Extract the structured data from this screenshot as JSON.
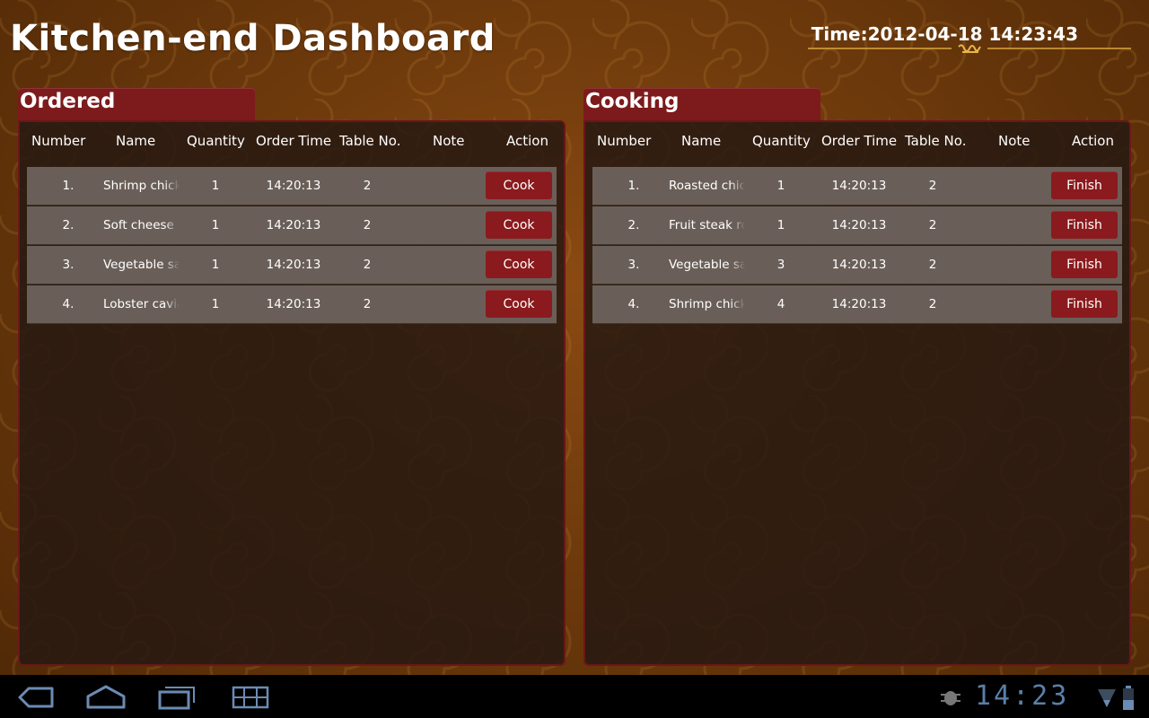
{
  "header": {
    "title": "Kitchen-end Dashboard",
    "time_label": "Time:2012-04-18 14:23:43"
  },
  "columns": [
    "Number",
    "Name",
    "Quantity",
    "Order Time",
    "Table No.",
    "Note",
    "Action"
  ],
  "ordered": {
    "title": "Ordered",
    "action_label": "Cook",
    "rows": [
      {
        "num": "1.",
        "name": "Shrimp chicken",
        "qty": "1",
        "time": "14:20:13",
        "table": "2"
      },
      {
        "num": "2.",
        "name": "Soft cheese with",
        "qty": "1",
        "time": "14:20:13",
        "table": "2"
      },
      {
        "num": "3.",
        "name": "Vegetable salad",
        "qty": "1",
        "time": "14:20:13",
        "table": "2"
      },
      {
        "num": "4.",
        "name": "Lobster caviar",
        "qty": "1",
        "time": "14:20:13",
        "table": "2"
      }
    ]
  },
  "cooking": {
    "title": "Cooking",
    "action_label": "Finish",
    "rows": [
      {
        "num": "1.",
        "name": "Roasted chicken",
        "qty": "1",
        "time": "14:20:13",
        "table": "2"
      },
      {
        "num": "2.",
        "name": "Fruit steak roll",
        "qty": "1",
        "time": "14:20:13",
        "table": "2"
      },
      {
        "num": "3.",
        "name": "Vegetable salad",
        "qty": "3",
        "time": "14:20:13",
        "table": "2"
      },
      {
        "num": "4.",
        "name": "Shrimp chicken",
        "qty": "4",
        "time": "14:20:13",
        "table": "2"
      }
    ]
  },
  "system_bar": {
    "clock": "14:23",
    "icons": [
      "back-icon",
      "home-icon",
      "recent-apps-icon",
      "menu-grid-icon",
      "debug-bug-icon",
      "wifi-signal-icon",
      "battery-icon"
    ],
    "icon_color": "#5a7fa8"
  },
  "colors": {
    "accent": "#7d1a1c",
    "button": "#8a1a1d",
    "row": "#6a5f58",
    "panel": "#261812"
  }
}
